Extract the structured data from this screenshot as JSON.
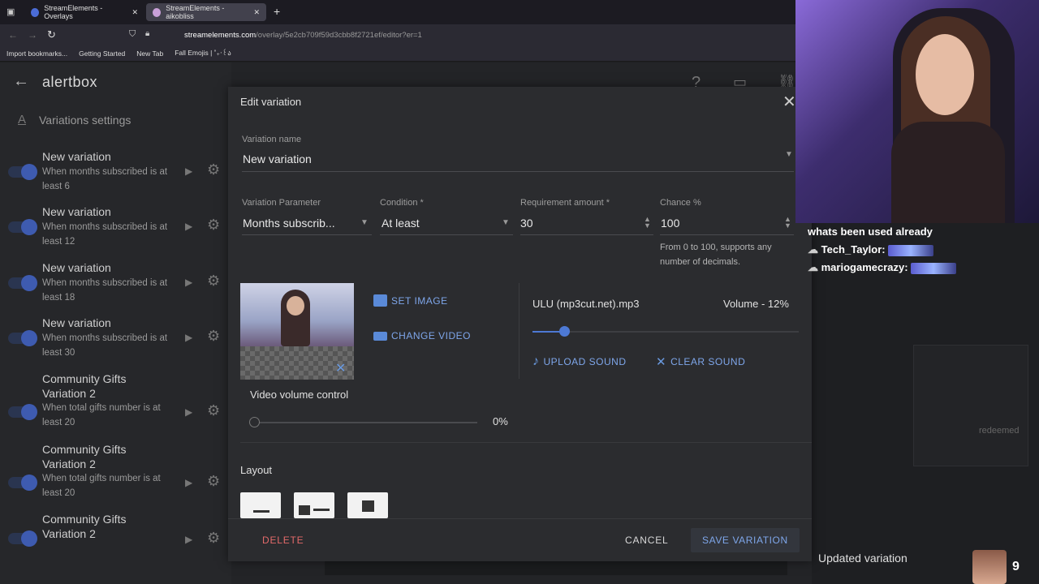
{
  "browser": {
    "tabs": [
      {
        "label": "StreamElements - Overlays"
      },
      {
        "label": "StreamElements - aikobliss"
      }
    ],
    "url_host": "streamelements.com",
    "url_path": "/overlay/5e2cb709f59d3cbb8f2721ef/editor?er=1",
    "bookmarks": [
      "Import bookmarks...",
      "Getting Started",
      "New Tab",
      "Fall Emojis | ˚₊‧꒰ა"
    ]
  },
  "app": {
    "title": "alertbox",
    "variations_header": "Variations settings"
  },
  "variations": [
    {
      "title": "New variation",
      "subtitle": "When months subscribed is at least 6"
    },
    {
      "title": "New variation",
      "subtitle": "When months subscribed is at least 12"
    },
    {
      "title": "New variation",
      "subtitle": "When months subscribed is at least 18"
    },
    {
      "title": "New variation",
      "subtitle": "When months subscribed is at least 30"
    },
    {
      "title": "Community Gifts Variation 2",
      "subtitle": "When total gifts number is at least 20"
    },
    {
      "title": "Community Gifts Variation 2",
      "subtitle": "When total gifts number is at least 20"
    },
    {
      "title": "Community Gifts Variation 2",
      "subtitle": ""
    }
  ],
  "modal": {
    "title": "Edit variation",
    "name_label": "Variation name",
    "name_value": "New variation",
    "param_label": "Variation Parameter",
    "param_value": "Months subscrib...",
    "condition_label": "Condition *",
    "condition_value": "At least",
    "req_label": "Requirement amount *",
    "req_value": "30",
    "chance_label": "Chance %",
    "chance_value": "100",
    "chance_hint": "From 0 to 100, supports any number of decimals.",
    "set_image": "SET IMAGE",
    "change_video": "CHANGE VIDEO",
    "sound_name": "ULU (mp3cut.net).mp3",
    "volume_label": "Volume - 12%",
    "volume_level": 0.12,
    "upload_sound": "UPLOAD SOUND",
    "clear_sound": "CLEAR SOUND",
    "video_volume_label": "Video volume control",
    "video_volume_value": "0%",
    "layout_label": "Layout",
    "delete": "DELETE",
    "cancel": "CANCEL",
    "save": "SAVE VARIATION"
  },
  "stream": {
    "chat": [
      {
        "user": "",
        "text": "whats been used already"
      },
      {
        "user": "Tech_Taylor:",
        "text": ""
      },
      {
        "user": "mariogamecrazy:",
        "text": ""
      }
    ],
    "redeemed": "redeemed",
    "toast": "Updated variation",
    "toast_count": "9"
  }
}
